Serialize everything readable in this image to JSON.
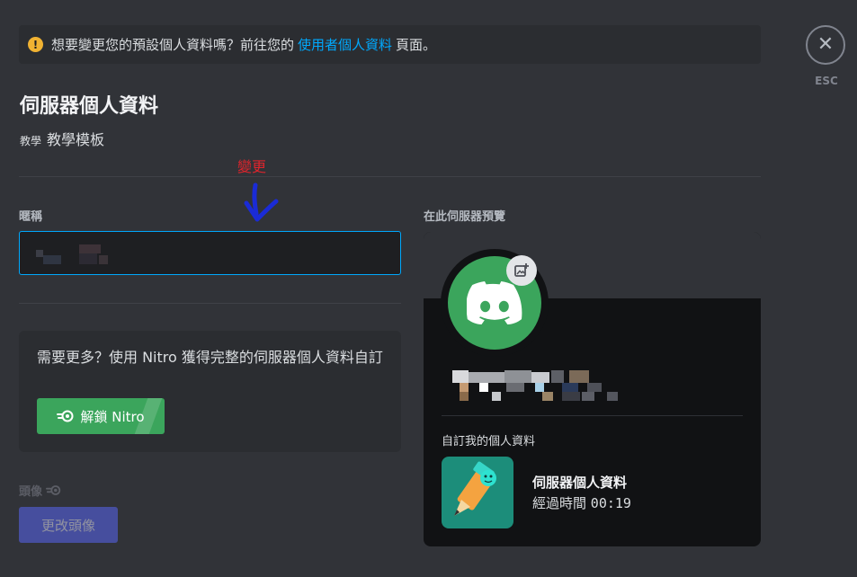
{
  "notice": {
    "icon": "warning-icon",
    "text_before": "想要變更您的預設個人資料嗎？前往您的",
    "link": "使用者個人資料",
    "text_after": "頁面。"
  },
  "close": {
    "icon": "close-icon",
    "label": "ESC"
  },
  "header": {
    "title": "伺服器個人資料",
    "server_tag": "教學",
    "server_name": "教學模板"
  },
  "annotation": {
    "text": "變更",
    "color": "#e0242c"
  },
  "nickname": {
    "label": "暱稱",
    "value": ""
  },
  "nitro_upsell": {
    "text": "需要更多？使用 Nitro 獲得完整的伺服器個人資料自訂",
    "button": "解鎖 Nitro"
  },
  "avatar_section": {
    "label": "頭像",
    "icon": "nitro-icon",
    "button": "更改頭像"
  },
  "preview": {
    "label": "在此伺服器預覽",
    "custom_label": "自訂我的個人資料",
    "activity": {
      "title": "伺服器個人資料",
      "elapsed_label": "經過時間",
      "elapsed": "00:19"
    }
  },
  "colors": {
    "background": "#313338",
    "accent_link": "#00a8fc",
    "nitro_green": "#3ba55c",
    "blurple": "#5865f2",
    "warning": "#f0b232"
  }
}
